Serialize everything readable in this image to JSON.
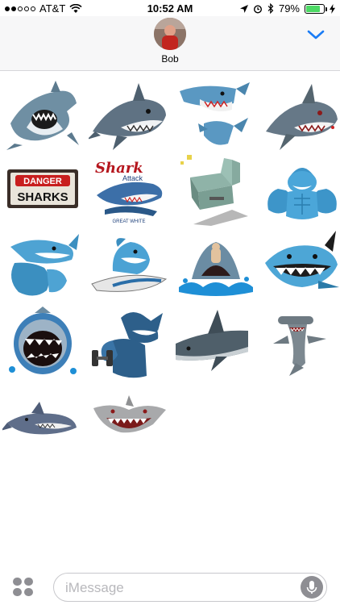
{
  "status_bar": {
    "carrier": "AT&T",
    "time": "10:52 AM",
    "battery_percent": "79%",
    "battery_level": 0.79,
    "icons": [
      "signal-dots-icon",
      "wifi-icon",
      "location-arrow-icon",
      "alarm-icon",
      "bluetooth-icon",
      "battery-icon",
      "charging-bolt-icon"
    ]
  },
  "header": {
    "contact_name": "Bob",
    "avatar_icon": "contact-avatar",
    "expand_icon": "chevron-down-icon",
    "accent": "#1a7cf5"
  },
  "stickers": {
    "items": [
      {
        "id": "shark-1",
        "kind": "shark"
      },
      {
        "id": "shark-2",
        "kind": "shark"
      },
      {
        "id": "shark-3",
        "kind": "shark-split"
      },
      {
        "id": "shark-4",
        "kind": "shark-angry"
      },
      {
        "id": "sign-danger",
        "kind": "sign",
        "line1": "DANGER",
        "line2": "SHARKS"
      },
      {
        "id": "shark-attack-logo",
        "kind": "logo",
        "text1": "Shark",
        "text2": "Attack",
        "text3": "GREAT WHITE"
      },
      {
        "id": "robot-shark",
        "kind": "robot"
      },
      {
        "id": "muscle-shark-1",
        "kind": "muscle"
      },
      {
        "id": "muscle-shark-2",
        "kind": "muscle-flex"
      },
      {
        "id": "surf-shark",
        "kind": "surf"
      },
      {
        "id": "splash-shark",
        "kind": "splash"
      },
      {
        "id": "grin-shark",
        "kind": "grin"
      },
      {
        "id": "jaws-shark",
        "kind": "jaws"
      },
      {
        "id": "dumbbell-shark",
        "kind": "dumbbell"
      },
      {
        "id": "swim-shark",
        "kind": "swim"
      },
      {
        "id": "hammerhead-shark",
        "kind": "hammerhead"
      },
      {
        "id": "shark-5",
        "kind": "shark-small"
      },
      {
        "id": "shark-6",
        "kind": "shark-gray"
      }
    ]
  },
  "compose": {
    "placeholder": "iMessage",
    "value": "",
    "apps_icon": "app-drawer-icon",
    "mic_icon": "microphone-icon"
  }
}
